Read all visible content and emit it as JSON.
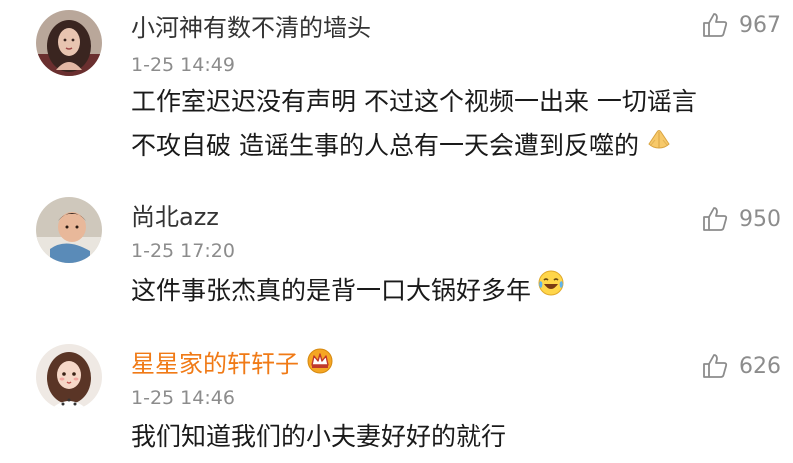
{
  "colors": {
    "text": "#1a1a1a",
    "username": "#333333",
    "vip_username": "#f07a16",
    "meta": "#8c8c8c"
  },
  "comments": [
    {
      "username": "小河神有数不清的墙头",
      "time": "1-25 14:49",
      "text_lines": [
        "工作室迟迟没有声明 不过这个视频一出来 一切谣言",
        "不攻自破  造谣生事的人总有一天会遭到反噬的"
      ],
      "emoji": "palms-together-icon",
      "likes": "967"
    },
    {
      "username": "尚北azz",
      "time": "1-25 17:20",
      "text_lines": [
        "这件事张杰真的是背一口大锅好多年"
      ],
      "emoji": "laugh-cry-icon",
      "likes": "950"
    },
    {
      "username": "星星家的轩轩子",
      "time": "1-25 14:46",
      "text_lines": [
        "我们知道我们的小夫妻好好的就行"
      ],
      "badge": "crown-icon",
      "likes": "626"
    }
  ]
}
